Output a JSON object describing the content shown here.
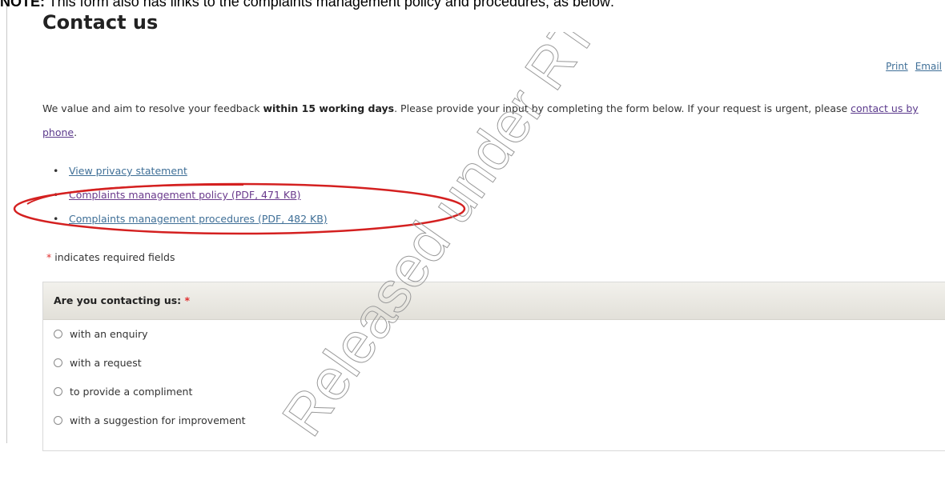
{
  "note": {
    "prefix": "NOTE:",
    "text": " This form also has links to the complaints management policy and procedures, as below:"
  },
  "page": {
    "title": "Contact us",
    "actions": [
      "Print",
      "Email"
    ]
  },
  "intro": {
    "part1": "We value and aim to resolve your feedback ",
    "bold": "within 15 working days",
    "part2": ". Please provide your input by completing the form below. If your request is urgent, please ",
    "link": "contact us by phone",
    "part3": "."
  },
  "links": [
    "View privacy statement",
    "Complaints management policy (PDF, 471 KB)",
    "Complaints management procedures (PDF, 482 KB)"
  ],
  "required_note": {
    "star": "*",
    "text": " indicates required fields"
  },
  "form": {
    "question": "Are you contacting us:",
    "required_star": "*",
    "options": [
      "with an enquiry",
      "with a request",
      "to provide a compliment",
      "with a suggestion for improvement"
    ]
  },
  "watermark": {
    "text": "Released under RTI"
  },
  "colors": {
    "link": "#3f6f97",
    "visited_link": "#6a3a8c",
    "required": "#e03030",
    "annotation_ellipse": "#d42020"
  }
}
